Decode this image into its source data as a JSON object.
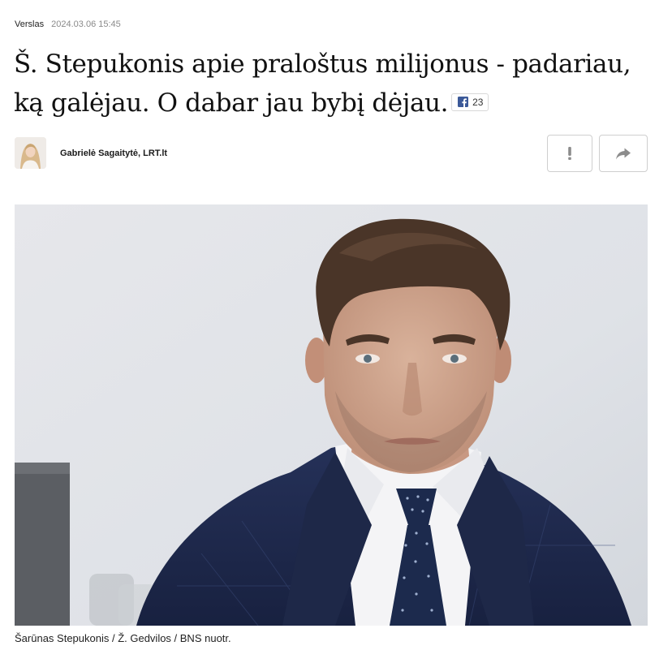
{
  "article": {
    "category": "Verslas",
    "datetime": "2024.03.06 15:45",
    "title": "Š. Stepukonis apie praloštus milijonus - padariau, ką galėjau. O dabar jau bybį dėjau.",
    "facebook_share_count": "23"
  },
  "author": {
    "name": "Gabrielė Sagaitytė, LRT.lt"
  },
  "actions": {
    "report_icon": "exclamation-icon",
    "share_icon": "share-arrow-icon"
  },
  "photo": {
    "caption": "Šarūnas Stepukonis / Ž. Gedvilos / BNS nuotr."
  },
  "colors": {
    "facebook_blue": "#3b5998",
    "icon_gray": "#8c8c8c",
    "button_border": "#cfcfcf",
    "suit_navy": "#1f2a44"
  }
}
